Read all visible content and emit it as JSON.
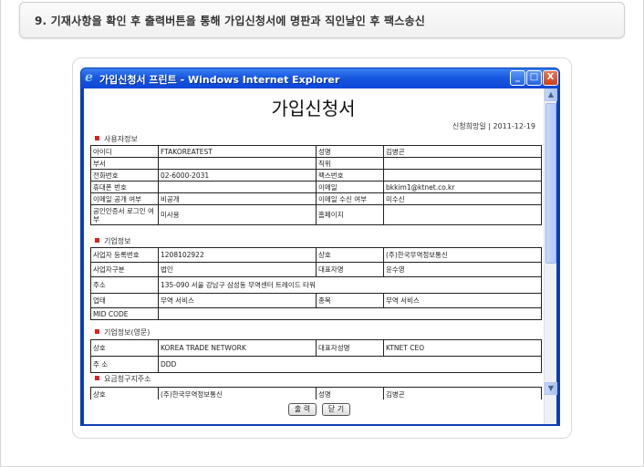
{
  "step": {
    "text": "9. 기재사항을 확인 후 출력버튼을 통해 가입신청서에 명판과 직인날인 후 팩스송신"
  },
  "window": {
    "title": "가입신청서 프린트 - Windows Internet Explorer",
    "minimize": "_",
    "maximize": "□",
    "close": "X"
  },
  "doc": {
    "title": "가입신청서",
    "apply_date": "신청희망일 | 2011-12-19"
  },
  "sections": {
    "user": "사용자정보",
    "company": "기업정보",
    "company_en": "기업정보(영문)",
    "billing": "요금청구지주소"
  },
  "user_rows": [
    [
      "아이디",
      "FTAKOREATEST",
      "성명",
      "김병곤"
    ],
    [
      "부서",
      "",
      "직위",
      ""
    ],
    [
      "전화번호",
      "02-6000-2031",
      "팩스번호",
      ""
    ],
    [
      "휴대폰 번호",
      "",
      "이메일",
      "bkkim1@ktnet.co.kr"
    ],
    [
      "이메일 공개 여부",
      "비공개",
      "이메일 수신 여부",
      "미수신"
    ],
    [
      "공인인증서 로그인 여부",
      "미사용",
      "홈페이지",
      ""
    ]
  ],
  "company_rows": [
    [
      "사업자 등록번호",
      "1208102922",
      "상호",
      "(주)한국무역정보통신"
    ],
    [
      "사업자구분",
      "법인",
      "대표자명",
      "윤수영"
    ]
  ],
  "company_address": {
    "label": "주소",
    "value": "135-090 서울 강남구 삼성동 무역센터 트레이드 타워"
  },
  "company_biz": [
    "업태",
    "무역 서비스",
    "종목",
    "무역 서비스"
  ],
  "company_mid": {
    "label": "MID CODE",
    "value": ""
  },
  "company_en_row": [
    "상호",
    "KOREA TRADE NETWORK",
    "대표자성명",
    "KTNET CEO"
  ],
  "company_en_address": {
    "label": "주 소",
    "value": "DDD"
  },
  "billing_partial": [
    "상호",
    "(주)한국무역정보통신",
    "성명",
    "김병곤"
  ],
  "buttons": {
    "print": "출 력",
    "close": "닫 기"
  }
}
